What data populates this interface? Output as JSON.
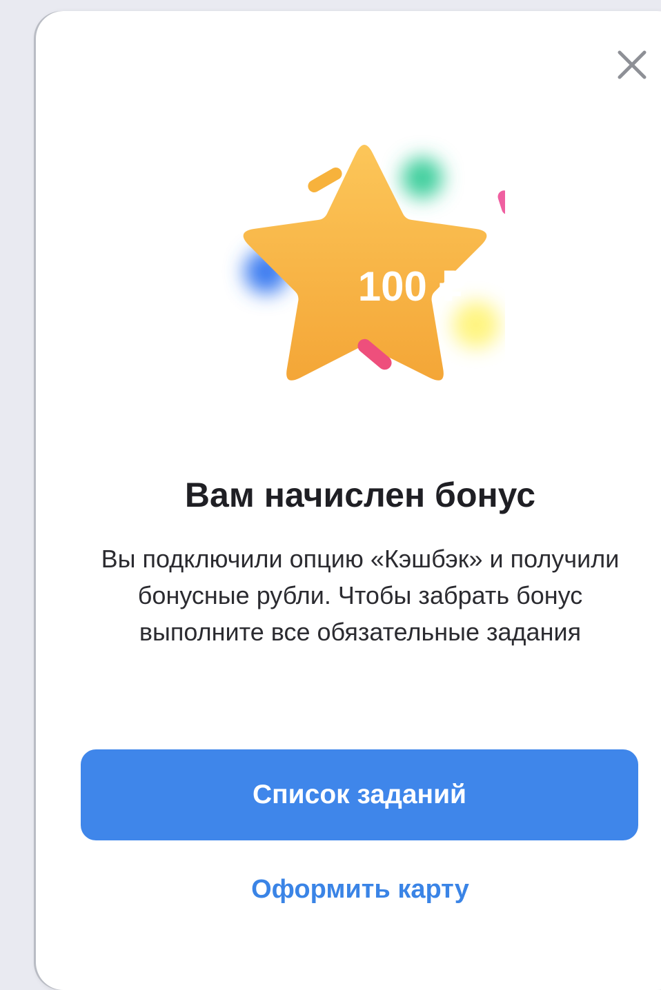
{
  "modal": {
    "close_icon": "close-icon",
    "badge_amount": "100 ₽",
    "title": "Вам начислен бонус",
    "description": "Вы подключили опцию «Кэшбэк» и получили бонусные рубли. Чтобы забрать бонус выполните все обязательные задания",
    "primary_button_label": "Список заданий",
    "secondary_link_label": "Оформить карту"
  },
  "colors": {
    "primary": "#3f86ea",
    "link": "#3a84e6",
    "star": "#f8b540",
    "background": "#e9eaf1"
  }
}
